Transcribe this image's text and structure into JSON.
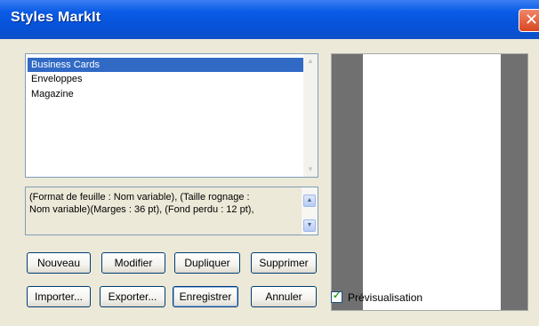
{
  "window": {
    "title": "Styles MarkIt",
    "close_glyph": "✕"
  },
  "styles_list": {
    "items": [
      {
        "label": "Business Cards",
        "selected": true
      },
      {
        "label": "Enveloppes",
        "selected": false
      },
      {
        "label": "Magazine",
        "selected": false
      }
    ]
  },
  "description": {
    "line1": "(Format de feuille : Nom variable), (Taille rognage :",
    "line2": "Nom variable)(Marges : 36 pt), (Fond perdu : 12 pt),"
  },
  "buttons": {
    "new": "Nouveau",
    "modify": "Modifier",
    "duplicate": "Dupliquer",
    "delete": "Supprimer",
    "import": "Importer...",
    "export": "Exporter...",
    "save": "Enregistrer",
    "cancel": "Annuler"
  },
  "preview": {
    "checkbox_label": "Prévisualisation",
    "checked": true
  },
  "colors": {
    "titlebar": "#0652d8",
    "selection": "#316ac5",
    "dialog_bg": "#ece9d8",
    "preview_margin": "#707070"
  }
}
